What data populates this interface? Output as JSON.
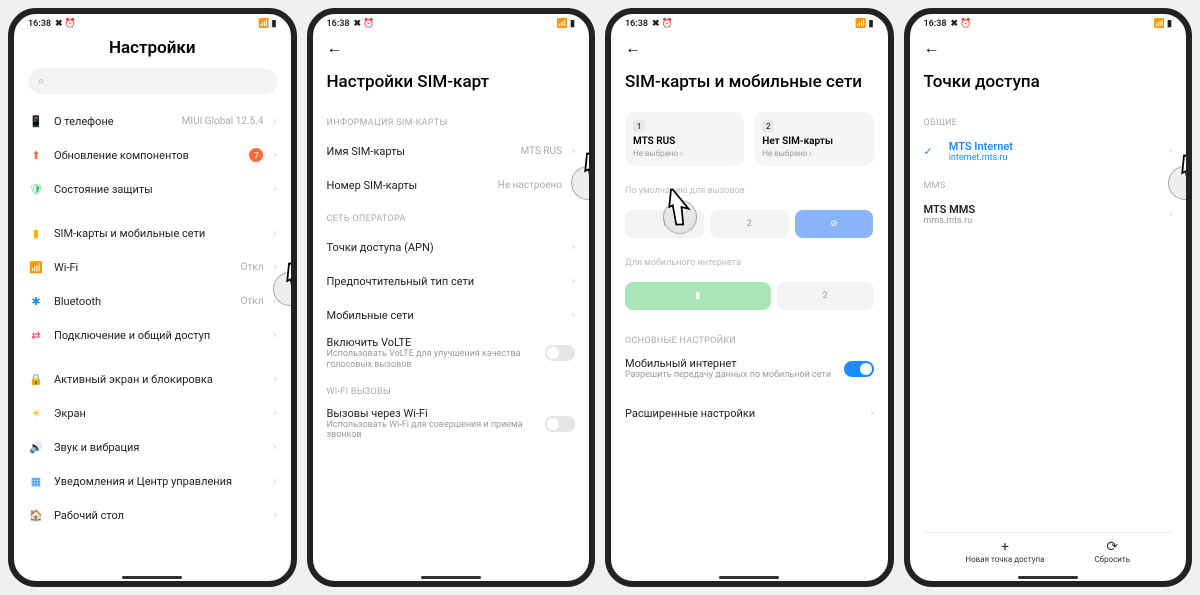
{
  "status": {
    "time": "16:38",
    "icons_left": "✖ ⏰",
    "icons_right": "📶 ▮"
  },
  "screen1": {
    "title": "Настройки",
    "search_placeholder": "",
    "items": [
      {
        "icon": "📱",
        "color": "#4aa3ff",
        "label": "О телефоне",
        "value": "MIUI Global 12.5.4"
      },
      {
        "icon": "⬆",
        "color": "#ff6b35",
        "label": "Обновление компонентов",
        "badge": "7"
      },
      {
        "icon": "🛡",
        "color": "#3fc97a",
        "label": "Состояние защиты"
      },
      null,
      {
        "icon": "▮",
        "color": "#ffb300",
        "label": "SIM-карты и мобильные сети"
      },
      {
        "icon": "📶",
        "color": "#1a8cff",
        "label": "Wi-Fi",
        "value": "Откл"
      },
      {
        "icon": "✱",
        "color": "#1a8cff",
        "label": "Bluetooth",
        "value": "Откл"
      },
      {
        "icon": "⇄",
        "color": "#ff3355",
        "label": "Подключение и общий доступ"
      },
      null,
      {
        "icon": "🔒",
        "color": "#ff4d4d",
        "label": "Активный экран и блокировка"
      },
      {
        "icon": "☀",
        "color": "#ffb300",
        "label": "Экран"
      },
      {
        "icon": "🔊",
        "color": "#3fc97a",
        "label": "Звук и вибрация"
      },
      {
        "icon": "▦",
        "color": "#1a8cff",
        "label": "Уведомления и Центр управления"
      },
      {
        "icon": "🏠",
        "color": "#1a8cff",
        "label": "Рабочий стол"
      }
    ]
  },
  "screen2": {
    "title": "Настройки SIM-карт",
    "sec1_label": "ИНФОРМАЦИЯ SIM-КАРТЫ",
    "rows1": [
      {
        "label": "Имя SIM-карты",
        "value": "MTS RUS"
      },
      {
        "label": "Номер SIM-карты",
        "value": "Не настроено"
      }
    ],
    "sec2_label": "СЕТЬ ОПЕРАТОРА",
    "rows2": [
      {
        "label": "Точки доступа (APN)"
      },
      {
        "label": "Предпочтительный тип сети"
      },
      {
        "label": "Мобильные сети"
      },
      {
        "label": "Включить VoLTE",
        "sub": "Использовать VoLTE для улучшения качества голосовых вызовов",
        "toggle": false
      }
    ],
    "sec3_label": "WI-FI ВЫЗОВЫ",
    "rows3": [
      {
        "label": "Вызовы через Wi-Fi",
        "sub": "Использовать Wi-Fi для совершения и приема звонков",
        "toggle": false
      }
    ]
  },
  "screen3": {
    "title": "SIM-карты и мобильные сети",
    "sims": [
      {
        "num": "1",
        "name": "MTS RUS",
        "sel": "Не выбрано ›"
      },
      {
        "num": "2",
        "name": "Нет SIM-карты",
        "sel": "Не выбрано ›"
      }
    ],
    "calls_label": "По умолчанию для вызовов",
    "data_label": "Для мобильного интернета",
    "sec_label": "ОСНОВНЫЕ НАСТРОЙКИ",
    "mobile": {
      "label": "Мобильный интернет",
      "sub": "Разрешить передачу данных по мобильной сети"
    },
    "advanced": "Расширенные настройки"
  },
  "screen4": {
    "title": "Точки доступа",
    "sec1": "ОБЩИЕ",
    "apn1": {
      "name": "MTS Internet",
      "url": "internet.mts.ru"
    },
    "sec2": "MMS",
    "apn2": {
      "name": "MTS MMS",
      "url": "mms.mts.ru"
    },
    "new_apn": "Новая точка доступа",
    "reset": "Сбросить"
  }
}
